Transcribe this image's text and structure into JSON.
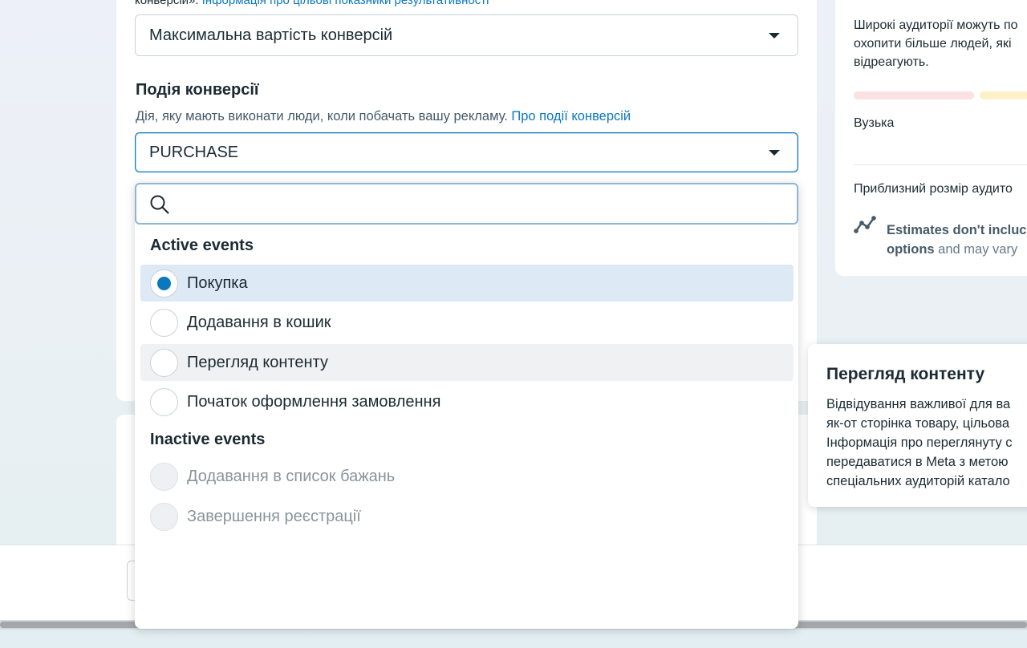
{
  "form": {
    "top_help_text": "конверсій».",
    "top_help_link": "Інформація про цільові показники результативності",
    "bid_strategy_value": "Максимальна вартість конверсій",
    "conversion_event_title": "Подія конверсії",
    "conversion_event_desc": "Дія, яку мають виконати люди, коли побачать вашу рекламу.",
    "conversion_event_link": "Про події конверсій",
    "conversion_event_value": "PURCHASE"
  },
  "dropdown": {
    "search_placeholder": "",
    "active_title": "Active events",
    "active_options": [
      {
        "label": "Покупка",
        "checked": true
      },
      {
        "label": "Додавання в кошик",
        "checked": false
      },
      {
        "label": "Перегляд контенту",
        "checked": false
      },
      {
        "label": "Початок оформлення замовлення",
        "checked": false
      }
    ],
    "inactive_title": "Inactive events",
    "inactive_options": [
      {
        "label": "Додавання в список бажань"
      },
      {
        "label": "Завершення реєстрації"
      }
    ]
  },
  "audience_panel": {
    "line1": "Широкі аудиторії можуть по",
    "line2": "охопити більше людей, які",
    "line3": "відреагують.",
    "narrow_label": "Вузька",
    "estimate_label": "Приблизний розмір аудито",
    "note_line1": "Estimates don't incluc",
    "note_line2_bold": "options",
    "note_line2_rest": " and may vary"
  },
  "tooltip": {
    "title": "Перегляд контенту",
    "lines": [
      "Відвідування важливої для ва",
      "як-от сторінка товару, цільова",
      "Інформація про переглянуту с",
      "передаватися в Meta з метою",
      "спеціальних аудиторій катало"
    ]
  },
  "colors": {
    "accent": "#0a78be",
    "selected_bg": "#dde9f5",
    "hover_bg": "#f0f1f3"
  }
}
